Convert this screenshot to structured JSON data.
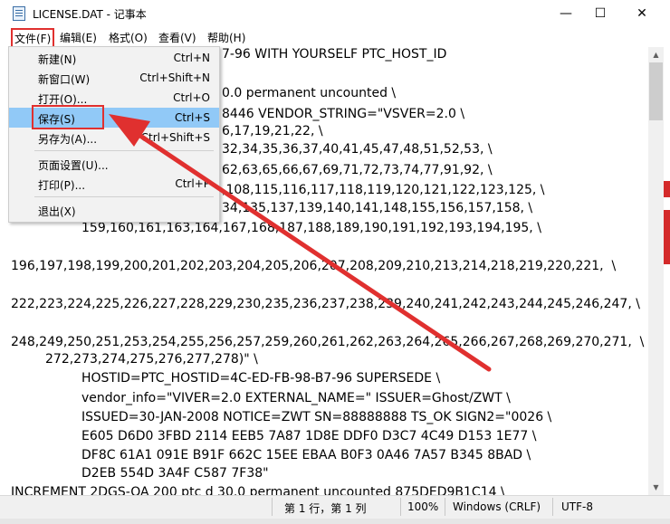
{
  "window": {
    "title": "LICENSE.DAT - 记事本",
    "minimize": "—",
    "maximize": "☐",
    "close": "✕"
  },
  "menu": {
    "file": "文件(F)",
    "edit": "编辑(E)",
    "format": "格式(O)",
    "view": "查看(V)",
    "help": "帮助(H)"
  },
  "file_menu": {
    "new": {
      "label": "新建(N)",
      "shortcut": "Ctrl+N"
    },
    "new_window": {
      "label": "新窗口(W)",
      "shortcut": "Ctrl+Shift+N"
    },
    "open": {
      "label": "打开(O)...",
      "shortcut": "Ctrl+O"
    },
    "save": {
      "label": "保存(S)",
      "shortcut": "Ctrl+S"
    },
    "save_as": {
      "label": "另存为(A)...",
      "shortcut": "Ctrl+Shift+S"
    },
    "page_setup": {
      "label": "页面设置(U)..."
    },
    "print": {
      "label": "打印(P)...",
      "shortcut": "Ctrl+P"
    },
    "exit": {
      "label": "退出(X)"
    }
  },
  "editor_lines": [
    "7-96 WITH YOURSELF PTC_HOST_ID",
    "0.0 permanent uncounted \\",
    "8446 VENDOR_STRING=\"VSVER=2.0 \\",
    "6,17,19,21,22, \\",
    "32,34,35,36,37,40,41,45,47,48,51,52,53, \\",
    "62,63,65,66,67,69,71,72,73,74,77,91,92, \\",
    ",108,115,116,117,118,119,120,121,122,123,125, \\",
    "34,135,137,139,140,141,148,155,156,157,158, \\",
    "159,160,161,163,164,167,168,187,188,189,190,191,192,193,194,195, \\",
    "196,197,198,199,200,201,202,203,204,205,206,207,208,209,210,213,214,218,219,220,221,  \\",
    "222,223,224,225,226,227,228,229,230,235,236,237,238,239,240,241,242,243,244,245,246,247, \\",
    "248,249,250,251,253,254,255,256,257,259,260,261,262,263,264,265,266,267,268,269,270,271,  \\",
    "272,273,274,275,276,277,278)\" \\",
    "HOSTID=PTC_HOSTID=4C-ED-FB-98-B7-96 SUPERSEDE \\",
    "vendor_info=\"VIVER=2.0 EXTERNAL_NAME=\" ISSUER=Ghost/ZWT \\",
    "ISSUED=30-JAN-2008 NOTICE=ZWT SN=88888888 TS_OK SIGN2=\"0026 \\",
    "E605 D6D0 3FBD 2114 EEB5 7A87 1D8E DDF0 D3C7 4C49 D153 1E77 \\",
    "DF8C 61A1 091E B91F 662C 15EE EBAA B0F3 0A46 7A57 B345 8BAD \\",
    "D2EB 554D 3A4F C587 7F38\"",
    "INCREMENT 2DGS-OA 200 ptc d 30.0 permanent uncounted 875DED9B1C14 \\"
  ],
  "status": {
    "position": "第 1 行，第 1 列",
    "zoom": "100%",
    "line_ending": "Windows (CRLF)",
    "encoding": "UTF-8"
  },
  "colors": {
    "highlight": "#91c9f7",
    "annotation_red": "#e0302f"
  }
}
